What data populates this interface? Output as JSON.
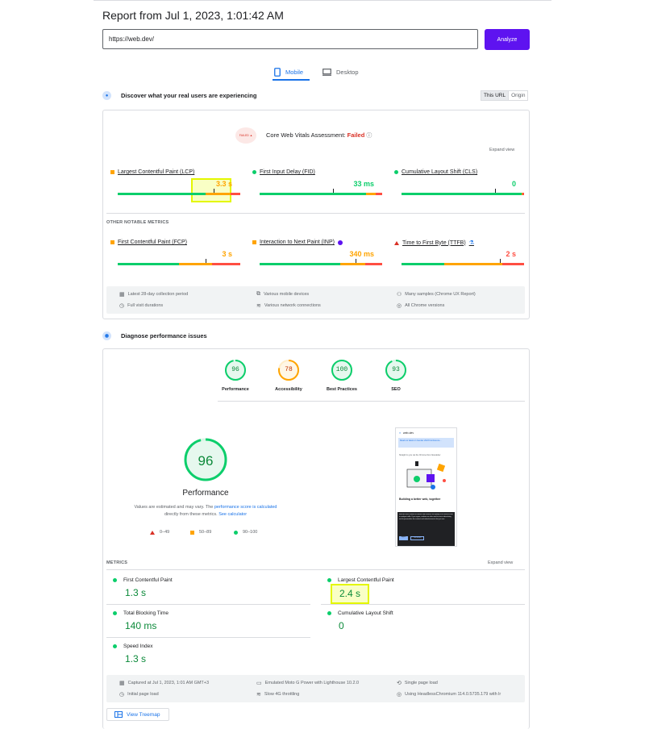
{
  "report": {
    "title": "Report from Jul 1, 2023, 1:01:42 AM",
    "url_value": "https://web.dev/",
    "analyze_label": "Analyze"
  },
  "tabs": [
    {
      "label": "Mobile",
      "active": true,
      "icon": "mobile-icon"
    },
    {
      "label": "Desktop",
      "active": false,
      "icon": "desktop-icon"
    }
  ],
  "field": {
    "heading": "Discover what your real users are experiencing",
    "toggle": {
      "this_url": "This URL",
      "origin": "Origin"
    },
    "badge_text": "FAILED ▲",
    "assessment_label": "Core Web Vitals Assessment:",
    "assessment_result": "Failed",
    "expand_view": "Expand view",
    "core_metrics": [
      {
        "label": "Largest Contentful Paint (LCP)",
        "value": "3.3 s",
        "rating": "average",
        "color": "#ffa400",
        "good": 0.72,
        "avg": 0.2,
        "marker": 0.78
      },
      {
        "label": "First Input Delay (FID)",
        "value": "33 ms",
        "rating": "good",
        "color": "#0cce6b",
        "good": 0.87,
        "avg": 0.08,
        "marker": 0.6
      },
      {
        "label": "Cumulative Layout Shift (CLS)",
        "value": "0",
        "rating": "good",
        "color": "#0cce6b",
        "good": 0.98,
        "avg": 0.01,
        "marker": 0.76
      }
    ],
    "other_heading": "OTHER NOTABLE METRICS",
    "other_metrics": [
      {
        "label": "First Contentful Paint (FCP)",
        "value": "3 s",
        "rating": "average",
        "color": "#ffa400",
        "good": 0.5,
        "avg": 0.27,
        "marker": 0.72
      },
      {
        "label": "Interaction to Next Paint (INP)",
        "value": "340 ms",
        "rating": "average",
        "color": "#ffa400",
        "good": 0.66,
        "avg": 0.2,
        "marker": 0.78
      },
      {
        "label": "Time to First Byte (TTFB)",
        "value": "2 s",
        "rating": "poor",
        "color": "#ff4e42",
        "good": 0.35,
        "avg": 0.47,
        "marker": 0.8
      }
    ],
    "footer": [
      {
        "icon": "calendar-icon",
        "text": "Latest 28-day collection period"
      },
      {
        "icon": "devices-icon",
        "text": "Various mobile devices"
      },
      {
        "icon": "samples-icon",
        "text": "Many samples (Chrome UX Report)"
      },
      {
        "icon": "stopwatch-icon",
        "text": "Full visit durations"
      },
      {
        "icon": "wifi-icon",
        "text": "Various network connections"
      },
      {
        "icon": "chrome-icon",
        "text": "All Chrome versions"
      }
    ]
  },
  "lab": {
    "heading": "Diagnose performance issues",
    "gauges": [
      {
        "score": "96",
        "label": "Performance",
        "color": "#0cce6b",
        "text_color": "#0c8a3a",
        "fill": 0.96
      },
      {
        "score": "78",
        "label": "Accessibility",
        "color": "#ffa400",
        "text_color": "#c33300",
        "fill": 0.78
      },
      {
        "score": "100",
        "label": "Best Practices",
        "color": "#0cce6b",
        "text_color": "#0c8a3a",
        "fill": 1.0
      },
      {
        "score": "93",
        "label": "SEO",
        "color": "#0cce6b",
        "text_color": "#0c8a3a",
        "fill": 0.93
      }
    ],
    "big_score": "96",
    "big_label": "Performance",
    "note_1": "Values are estimated and may vary. The",
    "note_link_1": "performance score is calculated",
    "note_2": "directly from these metrics.",
    "note_link_2": "See calculator",
    "legend": [
      "0–49",
      "50–89",
      "90–100"
    ],
    "thumb": {
      "logo": "web.dev",
      "banner": "Read our latest on Gender 2023 Conference...",
      "text1": "Straight to you via the Chrome Dev Newsletter",
      "headline": "Building a better web, together",
      "cookie": "web.dev uses cookies to deliver and enhance the quality of its services and to analyze traffic. If you agree, cookies are also used to serve advertising and to personalize the content and advertisements that you see.",
      "ok": "Agree",
      "no": "No thanks"
    },
    "metrics_heading": "METRICS",
    "expand_view": "Expand view",
    "metrics": [
      {
        "label": "First Contentful Paint",
        "value": "1.3 s"
      },
      {
        "label": "Largest Contentful Paint",
        "value": "2.4 s"
      },
      {
        "label": "Total Blocking Time",
        "value": "140 ms"
      },
      {
        "label": "Cumulative Layout Shift",
        "value": "0"
      },
      {
        "label": "Speed Index",
        "value": "1.3 s"
      }
    ],
    "footer": [
      {
        "icon": "calendar-icon",
        "text": "Captured at Jul 1, 2023, 1:01 AM GMT+3"
      },
      {
        "icon": "device-icon",
        "text": "Emulated Moto G Power with Lighthouse 10.2.0"
      },
      {
        "icon": "single-load-icon",
        "text": "Single page load"
      },
      {
        "icon": "stopwatch-icon",
        "text": "Initial page load"
      },
      {
        "icon": "wifi-icon",
        "text": "Slow 4G throttling"
      },
      {
        "icon": "chrome-icon",
        "text": "Using HeadlessChromium 114.0.5735.179 with lr"
      }
    ],
    "treemap_label": "View Treemap"
  }
}
